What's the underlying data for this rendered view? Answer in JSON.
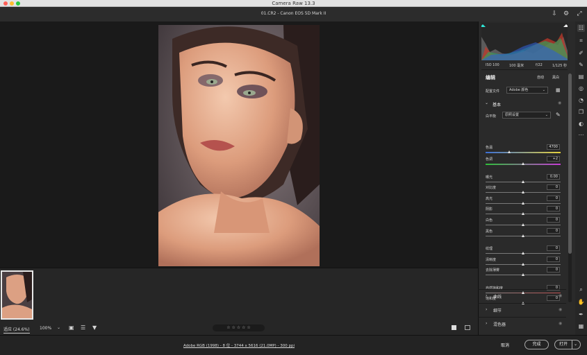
{
  "window_title": "Camera Raw 13.3",
  "file_title": "01.CR2 - Canon EOS 5D Mark II",
  "histogram_info": {
    "iso": "ISO 100",
    "focal": "100 毫米",
    "aperture": "f/22",
    "shutter": "1/125 秒"
  },
  "panel": {
    "edit_title": "编辑",
    "auto_label": "自动",
    "bw_label": "黑白",
    "profile_label": "配置文件",
    "profile_value": "Adobe 颜色",
    "basic_title": "基本",
    "wb_label": "白平衡",
    "wb_value": "原照设置",
    "sliders": [
      {
        "label": "色温",
        "value": "4700",
        "pos": 0.32
      },
      {
        "label": "色调",
        "value": "+2",
        "pos": 0.5
      },
      {
        "label": "曝光",
        "value": "0.00",
        "pos": 0.5
      },
      {
        "label": "对比度",
        "value": "0",
        "pos": 0.5
      },
      {
        "label": "高光",
        "value": "0",
        "pos": 0.5
      },
      {
        "label": "阴影",
        "value": "0",
        "pos": 0.5
      },
      {
        "label": "白色",
        "value": "0",
        "pos": 0.5
      },
      {
        "label": "黑色",
        "value": "0",
        "pos": 0.5
      },
      {
        "label": "纹理",
        "value": "0",
        "pos": 0.5
      },
      {
        "label": "清晰度",
        "value": "0",
        "pos": 0.5
      },
      {
        "label": "去除薄雾",
        "value": "0",
        "pos": 0.5
      },
      {
        "label": "自然饱和度",
        "value": "0",
        "pos": 0.5
      },
      {
        "label": "饱和度",
        "value": "0",
        "pos": 0.5
      }
    ],
    "sections": [
      "曲线",
      "细节",
      "混色器"
    ]
  },
  "bottombar": {
    "zoom_fit": "适应 (24.6%)",
    "zoom_100": "100%",
    "rating": "☆ ☆ ☆ ☆ ☆"
  },
  "footer": {
    "info": "Adobe RGB (1998) - 8 位 - 3744 x 5616 (21.0MP) - 300 ppi",
    "cancel": "取消",
    "done": "完成",
    "open": "打开"
  },
  "colors": {
    "accent": "#2e7cff",
    "panel_bg": "#2a2a2a"
  }
}
